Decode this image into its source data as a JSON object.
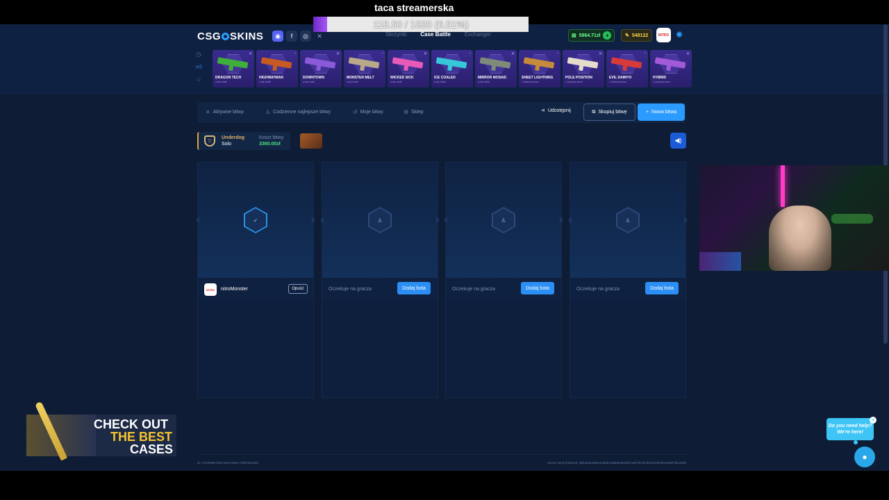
{
  "overlay": {
    "stream_title": "taca streamerska",
    "goal_text": "118.50 / 1820 (6.51%)",
    "goal_progress_percent": 6.51
  },
  "header": {
    "logo_left": "CSG",
    "logo_right": "SKINS",
    "nav": [
      "Skrzynki",
      "Case Battle",
      "Exchanger"
    ],
    "active_nav": "Case Battle",
    "balance": "5964.71zł",
    "coins": "548122",
    "avatar_text": "NITRO"
  },
  "cases": [
    {
      "name": "DRAGON TECH",
      "sub": "w tej chwili",
      "color": "#3fae3a"
    },
    {
      "name": "HIGHWAYMAN",
      "sub": "w tej chwili",
      "color": "#c65a22"
    },
    {
      "name": "DOWNTOWN",
      "sub": "w tej chwili",
      "color": "#8a5ad8"
    },
    {
      "name": "MONSTER MELT",
      "sub": "w tej chwili",
      "color": "#b9a88a"
    },
    {
      "name": "WICKED SICK",
      "sub": "w tej chwili",
      "color": "#e85ab8"
    },
    {
      "name": "ICE COALED",
      "sub": "w tej chwili",
      "color": "#36c7d8"
    },
    {
      "name": "MIRROR MOSAIC",
      "sub": "w tej chwili",
      "color": "#7e8a7a"
    },
    {
      "name": "SHEET LIGHTNING",
      "sub": "1 sekundy temu",
      "color": "#c58a3a"
    },
    {
      "name": "POLE POSITION",
      "sub": "1 sekundy temu",
      "color": "#e6dccc"
    },
    {
      "name": "EVIL DAIMYO",
      "sub": "1 sekundy temu",
      "color": "#d83a3a"
    },
    {
      "name": "HYBRID",
      "sub": "1 sekundy temu",
      "color": "#a25ad8"
    }
  ],
  "tabs": {
    "active": "Aktywne bitwy",
    "best": "Codzienne najlepsze bitwy",
    "mine": "Moje bitwy",
    "shop": "Sklep",
    "share": "Udostępnij",
    "copy": "Skopiuj bitwę",
    "new": "Nowa bitwa"
  },
  "battle": {
    "mode": "Underdog",
    "type": "Solo",
    "cost_label": "Koszt bitwy",
    "cost_value": "3360.00zł"
  },
  "slots": [
    {
      "player": "nitroMonster",
      "avatar_text": "NITRO",
      "leave": "Opuść"
    },
    {
      "wait": "Oczekuje na gracza",
      "button": "Dodaj bota"
    },
    {
      "wait": "Oczekuje na gracza",
      "button": "Dodaj bota"
    },
    {
      "wait": "Oczekuje na gracza",
      "button": "Dodaj bota"
    }
  ],
  "footer": {
    "id": "ID: 2783f689-f26d-44ee-8864-75f0fcb84d28",
    "seed": "Server seed (hashed): 0bba0dc486b0a4d5b12980de9548d7ad0700cffcb543c2f0394496d87f81d396"
  },
  "promo": {
    "line1": "CHECK OUT",
    "line2": "THE BEST",
    "line3": "CASES"
  },
  "help": {
    "line1": "Do you need help?",
    "line2": "We're here!"
  }
}
